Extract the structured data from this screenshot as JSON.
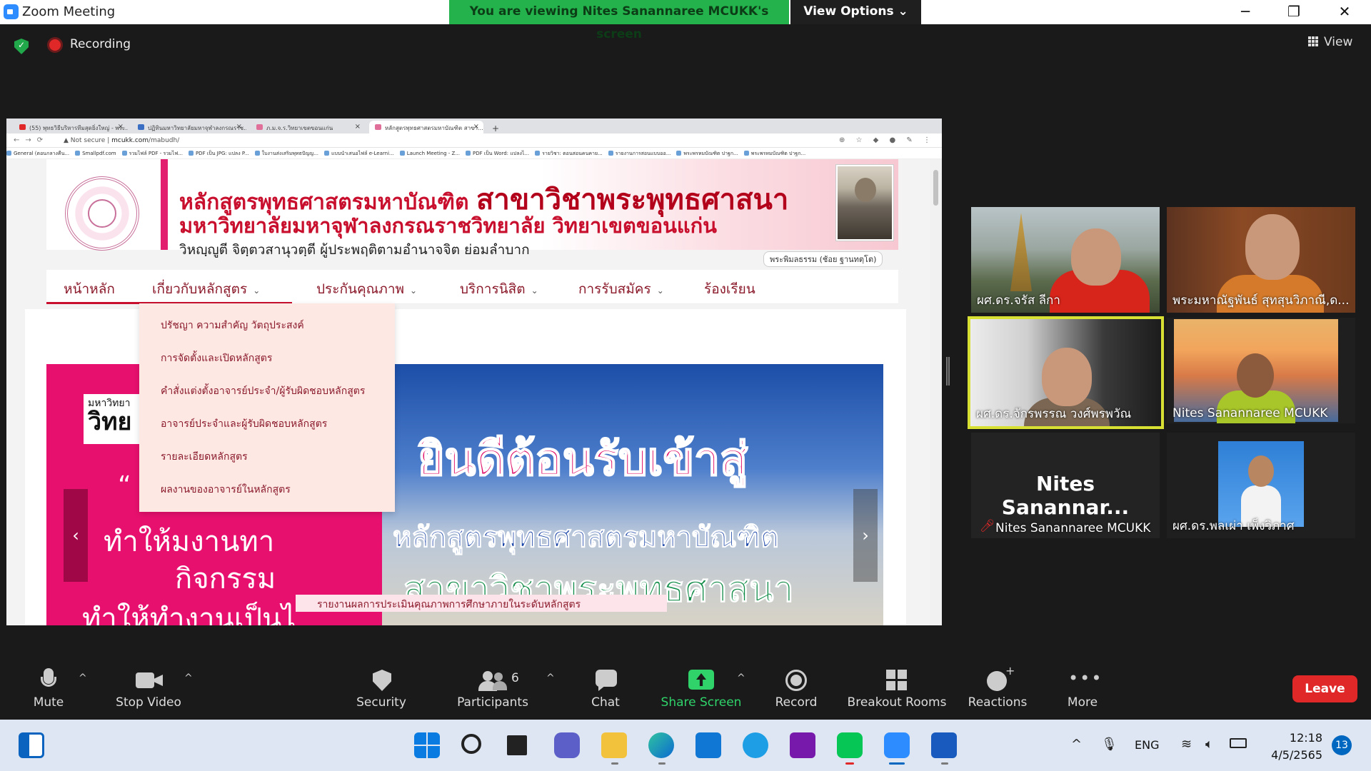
{
  "window": {
    "title": "Zoom Meeting",
    "viewing_banner": "You are viewing Nites Sanannaree MCUKK's screen",
    "view_options": "View Options",
    "controls": {
      "minimize": "─",
      "restore": "❐",
      "close": "✕"
    }
  },
  "meeting": {
    "recording_label": "Recording",
    "view_label": "View"
  },
  "browser": {
    "tabs": [
      {
        "title": "(55) พุทธวิธีบริหารทีมสุดยิ่งใหญ่ - พระ..."
      },
      {
        "title": "ปฏิทินมหาวิทยาลัยมหาจุฬาลงกรณราช..."
      },
      {
        "title": "ภ.ม.จ.ร.วิทยาเขตขอนแก่น"
      },
      {
        "title": "หลักสูตรพุทธศาสตรมหาบัณฑิต สาขา..."
      }
    ],
    "new_tab": "+",
    "security": "Not secure",
    "url_domain": "mcukk.com",
    "url_path": "/mabudh/",
    "bookmarks": [
      "General (ตอนกลางคืน...",
      "Smallpdf.com",
      "รวมไฟล์ PDF - รวมไฟ...",
      "PDF เป็น JPG: แปลง P...",
      "ใบงานส่งเสริมพุทธปัญญ...",
      "แบบนำเสนอไฟล์ e-Learni...",
      "Launch Meeting - Z...",
      "PDF เป็น Word: แปลงไ...",
      "รายวิชา: ตอนสอนคนคาย...",
      "รายงานการสอนแบบออ...",
      "พระพรหมบัณฑิต ปาฐก...",
      "พระพรหมบัณฑิต ปาฐก..."
    ]
  },
  "site": {
    "header_line1_a": "หลักสูตรพุทธศาสตรมหาบัณฑิต",
    "header_line1_b": "สาขาวิชาพระพุทธศาสนา",
    "header_line2": "มหาวิทยาลัยมหาจุฬาลงกรณราชวิทยาลัย วิทยาเขตขอนแก่น",
    "header_line3": "วิหญฺญูตี จิตฺตวสานุวตฺตี   ผู้ประพฤติตามอำนาจจิต ย่อมลำบาก",
    "monk_caption": "พระพิมลธรรม (ช้อย ฐานทตฺโต)",
    "nav": [
      {
        "label": "หน้าหลัก",
        "caret": ""
      },
      {
        "label": "เกี่ยวกับหลักสูตร",
        "caret": "⌄"
      },
      {
        "label": "ประกันคุณภาพ",
        "caret": "⌄"
      },
      {
        "label": "บริการนิสิต",
        "caret": "⌄"
      },
      {
        "label": "การรับสมัคร",
        "caret": "⌄"
      },
      {
        "label": "ร้องเรียน",
        "caret": ""
      }
    ],
    "dropdown": [
      "ปรัชญา ความสำคัญ วัตถุประสงค์",
      "การจัดตั้งและเปิดหลักสูตร",
      "คำสั่งแต่งตั้งอาจารย์ประจำ/ผู้รับผิดชอบหลักสูตร",
      "อาจารย์ประจำและผู้รับผิดชอบหลักสูตร",
      "รายละเอียดหลักสูตร",
      "ผลงานของอาจารย์ในหลักสูตร"
    ],
    "slide_left": {
      "logo_small": "มหาวิทยา",
      "logo_big": "วิทย",
      "quote": "“",
      "line1": "ทำให้มงานทา",
      "line2": "กิจกรรม",
      "line3": "ทำให้ทำงานเป็นไ"
    },
    "slide_right": {
      "welcome": "ยินดีต้อนรับเข้าสู่",
      "course": "หลักสูตรพุทธศาสตรมหาบัณฑิต",
      "branch": "สาขาวิชาพระพุทธศาสนา"
    },
    "arrow_prev": "‹",
    "arrow_next": "›",
    "report_strip": "รายงานผลการประเมินคุณภาพการศึกษาภายในระดับหลักสูตร"
  },
  "participants": [
    {
      "name": "ผศ.ดร.จรัส  ลีกา",
      "speaking": false
    },
    {
      "name": "พระมหาณัฐพันธ์ สุทสุนวิภาณี,ด...",
      "speaking": false
    },
    {
      "name": "ผศ.ดร.จักรพรรณ วงศ์พรพวัณ",
      "speaking": true
    },
    {
      "name": "Nites Sanannaree MCUKK",
      "speaking": false
    },
    {
      "name": "Nites Sanannaree MCUKK",
      "avatar_text": "Nites  Sanannar...",
      "muted": true,
      "speaking": false
    },
    {
      "name": "ผศ.ดร.พลเผ่า เพ็งวิภาศ",
      "speaking": false
    }
  ],
  "toolbar": {
    "mute": "Mute",
    "stop_video": "Stop Video",
    "security": "Security",
    "participants": "Participants",
    "participants_count": "6",
    "chat": "Chat",
    "share_screen": "Share Screen",
    "record": "Record",
    "breakout_rooms": "Breakout Rooms",
    "reactions": "Reactions",
    "more": "More",
    "leave": "Leave",
    "caret": "^"
  },
  "taskbar": {
    "lang": "ENG",
    "time": "12:18",
    "date": "4/5/2565",
    "notifications": "13"
  },
  "colors": {
    "zoom_blue": "#2d8cff",
    "banner_green": "#23b24b",
    "leave_red": "#e02828",
    "site_pink": "#e21e6e",
    "speaking_border": "#d7e033"
  }
}
